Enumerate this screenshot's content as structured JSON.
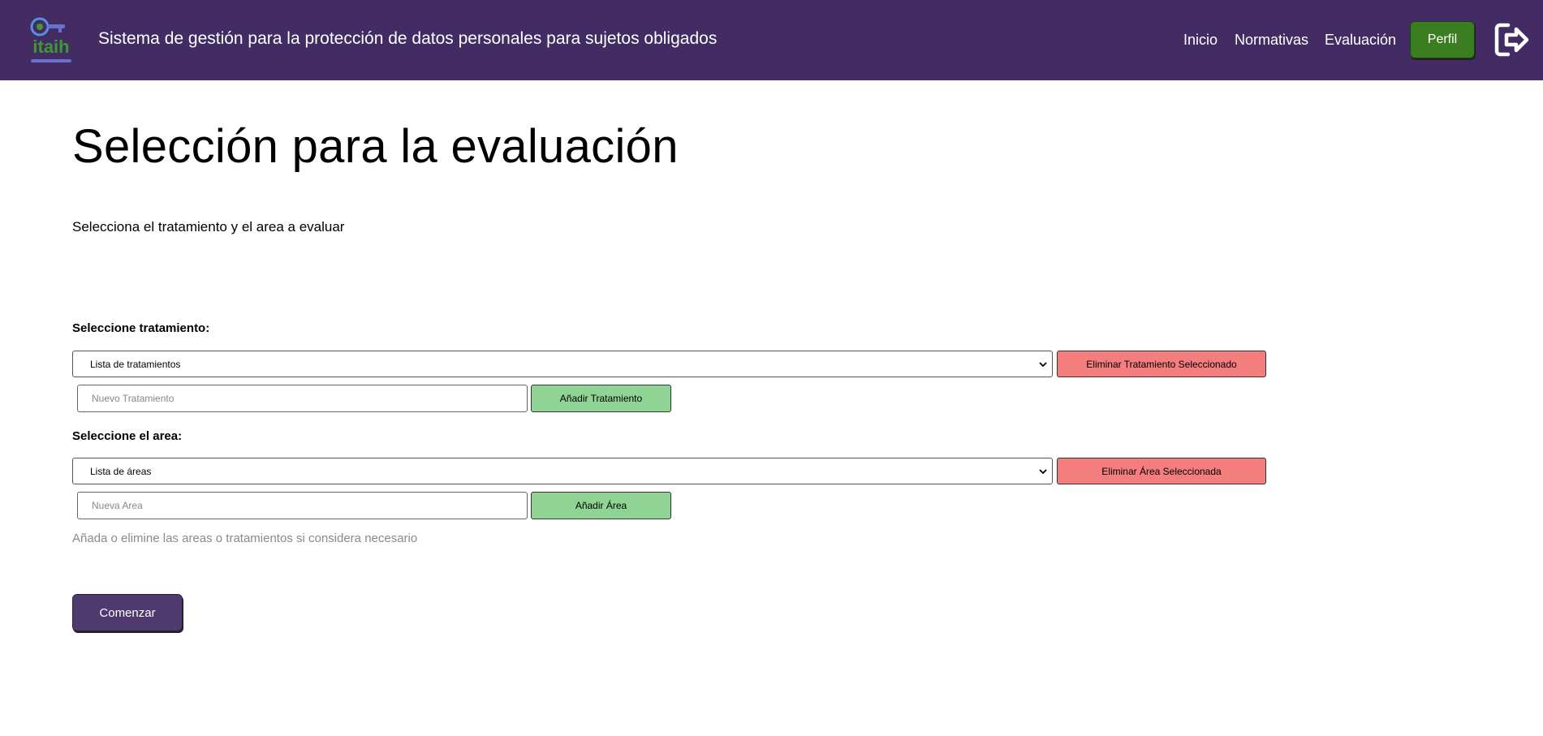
{
  "header": {
    "logo_text": "itaih",
    "app_title": "Sistema de gestión para la protección de datos personales para sujetos obligados",
    "nav": [
      {
        "label": "Inicio"
      },
      {
        "label": "Normativas"
      },
      {
        "label": "Evaluación"
      }
    ],
    "profile_label": "Perfil",
    "logout_icon": "logout-icon",
    "colors": {
      "navbar": "#432c63",
      "profile_button": "#3b7e22"
    }
  },
  "main": {
    "title": "Selección para la evaluación",
    "subtitle": "Selecciona el tratamiento y el area a evaluar",
    "treatment": {
      "label": "Seleccione tratamiento:",
      "select_value": "Lista de tratamientos",
      "delete_label": "Eliminar Tratamiento Seleccionado",
      "input_placeholder": "Nuevo Tratamiento",
      "add_label": "Añadir Tratamiento"
    },
    "area": {
      "label": "Seleccione el area:",
      "select_value": "Lista de áreas",
      "delete_label": "Eliminar Área Seleccionada",
      "input_placeholder": "Nueva Area",
      "add_label": "Añadir Área"
    },
    "help_text": "Añada o elimine las areas o tratamientos si considera necesario",
    "start_label": "Comenzar",
    "colors": {
      "delete_button": "#f47d7e",
      "add_button": "#8fd495",
      "start_button": "#4f3a6d"
    }
  }
}
